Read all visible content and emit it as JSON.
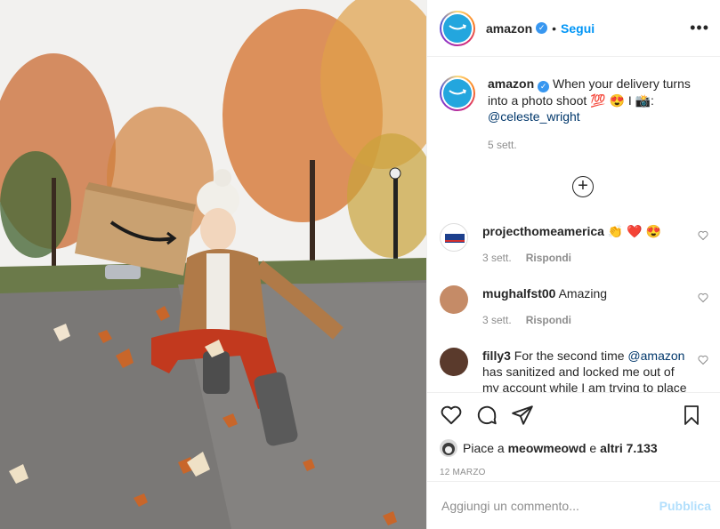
{
  "photo": {
    "box_logo": "amazon smile logo"
  },
  "header": {
    "username": "amazon",
    "separator": "•",
    "follow_label": "Segui",
    "more_label": "•••"
  },
  "caption": {
    "username": "amazon",
    "text": "When your delivery turns into a photo shoot 💯 😍 I 📸:",
    "mention": "@celeste_wright",
    "time": "5 sett."
  },
  "load_more": "+",
  "comments": [
    {
      "username": "projecthomeamerica",
      "text": "👏 ❤️ 😍",
      "time": "3 sett.",
      "reply": "Rispondi"
    },
    {
      "username": "mughalfst00",
      "text": "Amazing",
      "time": "3 sett.",
      "reply": "Rispondi"
    },
    {
      "username": "filly3",
      "text_before": "For the second time",
      "mention": "@amazon",
      "text_after": "has sanitized and locked me out of my account while I am trying to place"
    }
  ],
  "likes": {
    "prefix": "Piace a",
    "user": "meowmeowd",
    "middle": "e",
    "others": "altri 7.133"
  },
  "date": "12 MARZO",
  "add_comment": {
    "placeholder": "Aggiungi un commento...",
    "publish": "Pubblica"
  },
  "colors": {
    "accent": "#0095f6",
    "verified": "#3897f0",
    "heart": "#ed4956"
  }
}
